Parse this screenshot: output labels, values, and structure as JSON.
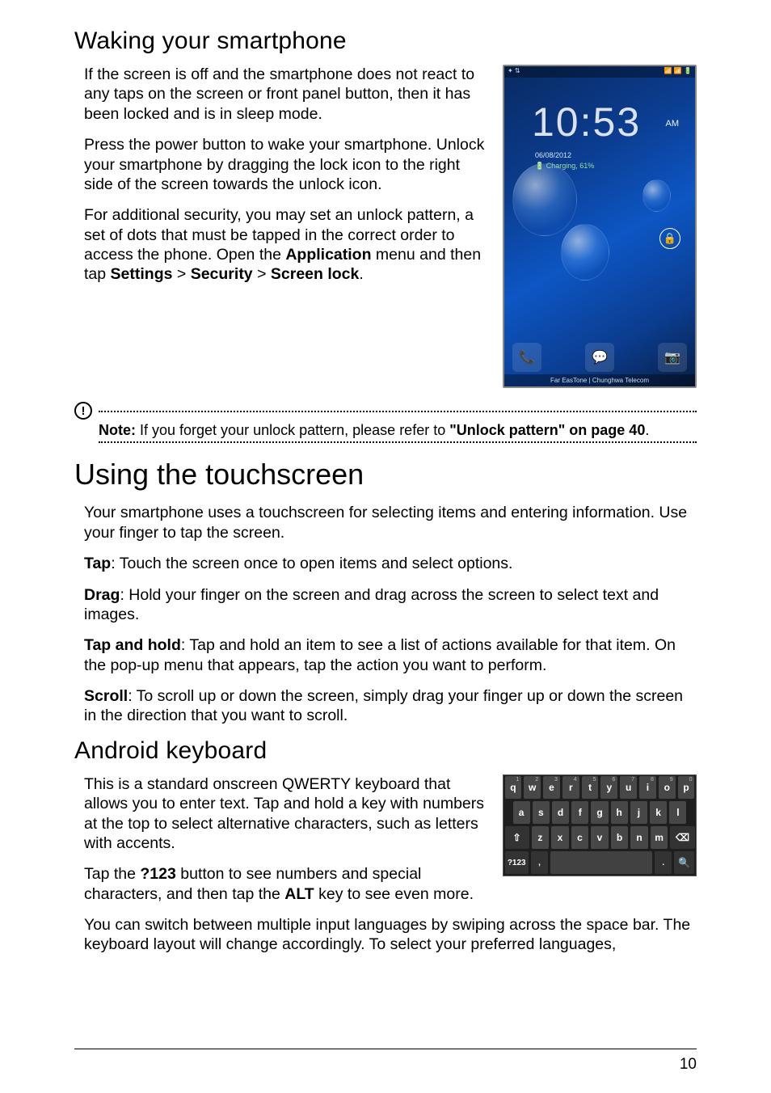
{
  "section1": {
    "heading": "Waking your smartphone",
    "p1": "If the screen is off and the smartphone does not react to any taps on the screen or front panel button, then it has been locked and is in sleep mode.",
    "p2": "Press the power button to wake your smartphone. Unlock your smartphone by dragging the lock icon to the right side of the screen towards the unlock icon.",
    "p3_pre": "For additional security, you may set an unlock pattern, a set of dots that must be tapped in the correct order to access the phone. Open the ",
    "p3_app": "Application",
    "p3_mid1": " menu and then tap ",
    "p3_settings": "Settings",
    "p3_gt1": " > ",
    "p3_security": "Security",
    "p3_gt2": " > ",
    "p3_screenlock": "Screen lock",
    "p3_end": "."
  },
  "phone": {
    "status_left": "✦  ⇅",
    "status_right": "📶 📶 🔋",
    "clock": "10:53",
    "ampm": "AM",
    "date": "06/08/2012",
    "charging": "🔋 Charging, 61%",
    "carrier": "Far EasTone  |  Chunghwa Telecom"
  },
  "note": {
    "label": "Note:",
    "text_mid": " If you forget your unlock pattern, please refer to ",
    "link": "\"Unlock pattern\" on page 40",
    "end": "."
  },
  "section2": {
    "heading": "Using the touchscreen",
    "intro": "Your smartphone uses a touchscreen for selecting items and entering information. Use your finger to tap the screen.",
    "tap_label": "Tap",
    "tap_text": ": Touch the screen once to open items and select options.",
    "drag_label": "Drag",
    "drag_text": ": Hold your finger on the screen and drag across the screen to select text and images.",
    "taphold_label": "Tap and hold",
    "taphold_text": ": Tap and hold an item to see a list of actions available for that item. On the pop-up menu that appears, tap the action you want to perform.",
    "scroll_label": "Scroll",
    "scroll_text": ": To scroll up or down the screen, simply drag your finger up or down the screen in the direction that you want to scroll."
  },
  "section3": {
    "heading": "Android keyboard",
    "p1": "This is a standard onscreen QWERTY keyboard that allows you to enter text. Tap and hold a key with numbers at the top to select alternative characters, such as letters with accents.",
    "p2_pre": "Tap the ",
    "p2_btn": "?123",
    "p2_mid": " button to see numbers and special characters, and then tap the ",
    "p2_alt": "ALT",
    "p2_end": " key to see even more.",
    "p3": "You can switch between multiple input languages by swiping across the space bar. The keyboard layout will change accordingly. To select your preferred languages,"
  },
  "keyboard": {
    "row1": [
      "q",
      "w",
      "e",
      "r",
      "t",
      "y",
      "u",
      "i",
      "o",
      "p"
    ],
    "row1_sup": [
      "1",
      "2",
      "3",
      "4",
      "5",
      "6",
      "7",
      "8",
      "9",
      "0"
    ],
    "row2": [
      "a",
      "s",
      "d",
      "f",
      "g",
      "h",
      "j",
      "k",
      "l"
    ],
    "row3_shift": "⇧",
    "row3": [
      "z",
      "x",
      "c",
      "v",
      "b",
      "n",
      "m"
    ],
    "row3_back": "⌫",
    "row4_mode": "?123",
    "row4_comma": ",",
    "row4_dot": ".",
    "row4_go": "🔍"
  },
  "page_number": "10"
}
